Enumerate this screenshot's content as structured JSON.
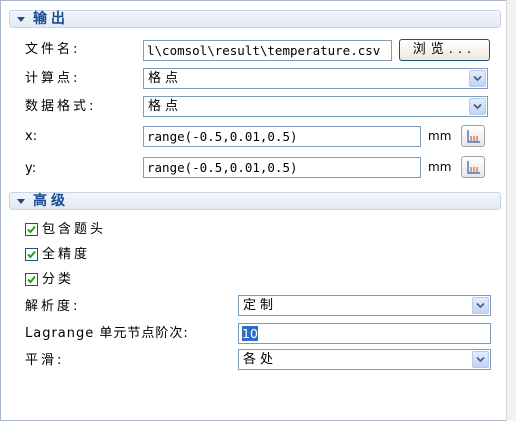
{
  "output": {
    "title": "输出",
    "filename_label": "文件名:",
    "filename_value": "l\\comsol\\result\\temperature.csv",
    "browse_label": "浏览...",
    "calc_point_label": "计算点:",
    "calc_point_value": "格点",
    "data_format_label": "数据格式:",
    "data_format_value": "格点",
    "x_label": "x:",
    "x_value": "range(-0.5,0.01,0.5)",
    "x_unit": "mm",
    "y_label": "y:",
    "y_value": "range(-0.5,0.01,0.5)",
    "y_unit": "mm"
  },
  "advanced": {
    "title": "高级",
    "include_header_label": "包含题头",
    "include_header_checked": true,
    "full_precision_label": "全精度",
    "full_precision_checked": true,
    "classify_label": "分类",
    "classify_checked": true,
    "resolution_label": "解析度:",
    "resolution_value": "定制",
    "lagrange_label": "Lagrange 单元节点阶次:",
    "lagrange_value": "10",
    "smoothing_label": "平滑:",
    "smoothing_value": "各处"
  },
  "colors": {
    "header_text": "#1b4b8f",
    "checkmark": "#21a121",
    "selection": "#316ac5"
  }
}
